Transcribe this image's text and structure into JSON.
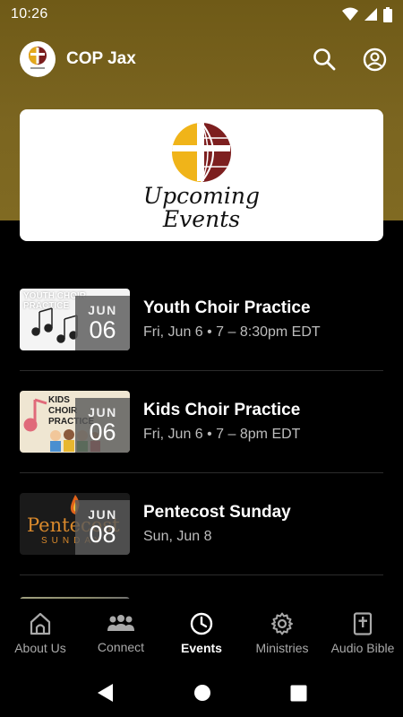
{
  "status_bar": {
    "time": "10:26",
    "icons": [
      "wifi-icon",
      "signal-icon",
      "battery-icon"
    ]
  },
  "app_bar": {
    "title": "COP Jax",
    "actions": [
      "search-icon",
      "account-circle-icon"
    ]
  },
  "hero": {
    "line1": "Upcoming",
    "line2": "Events"
  },
  "events": [
    {
      "title": "Youth Choir Practice",
      "time": "Fri, Jun 6 • 7 – 8:30pm EDT",
      "month": "JUN",
      "day": "06",
      "thumb_text": "YOUTH CHOIR PRACTICE"
    },
    {
      "title": "Kids Choir Practice",
      "time": "Fri, Jun 6 • 7 – 8pm EDT",
      "month": "JUN",
      "day": "06",
      "thumb_text": "KIDS CHOIR PRACTICE"
    },
    {
      "title": "Pentecost Sunday",
      "time": "Sun, Jun 8",
      "month": "JUN",
      "day": "08",
      "thumb_text": "Pentecost",
      "thumb_subtext": "SUNDAY"
    }
  ],
  "bottom_nav": [
    {
      "label": "About Us",
      "icon": "church-icon"
    },
    {
      "label": "Connect",
      "icon": "people-icon"
    },
    {
      "label": "Events",
      "icon": "clock-icon",
      "active": true
    },
    {
      "label": "Ministries",
      "icon": "gear-icon"
    },
    {
      "label": "Audio Bible",
      "icon": "bible-icon"
    }
  ],
  "colors": {
    "header_gold": "#7b6520",
    "background": "#000000",
    "card": "#ffffff",
    "active_nav": "#ffffff",
    "inactive_nav": "#a9a9a9"
  }
}
